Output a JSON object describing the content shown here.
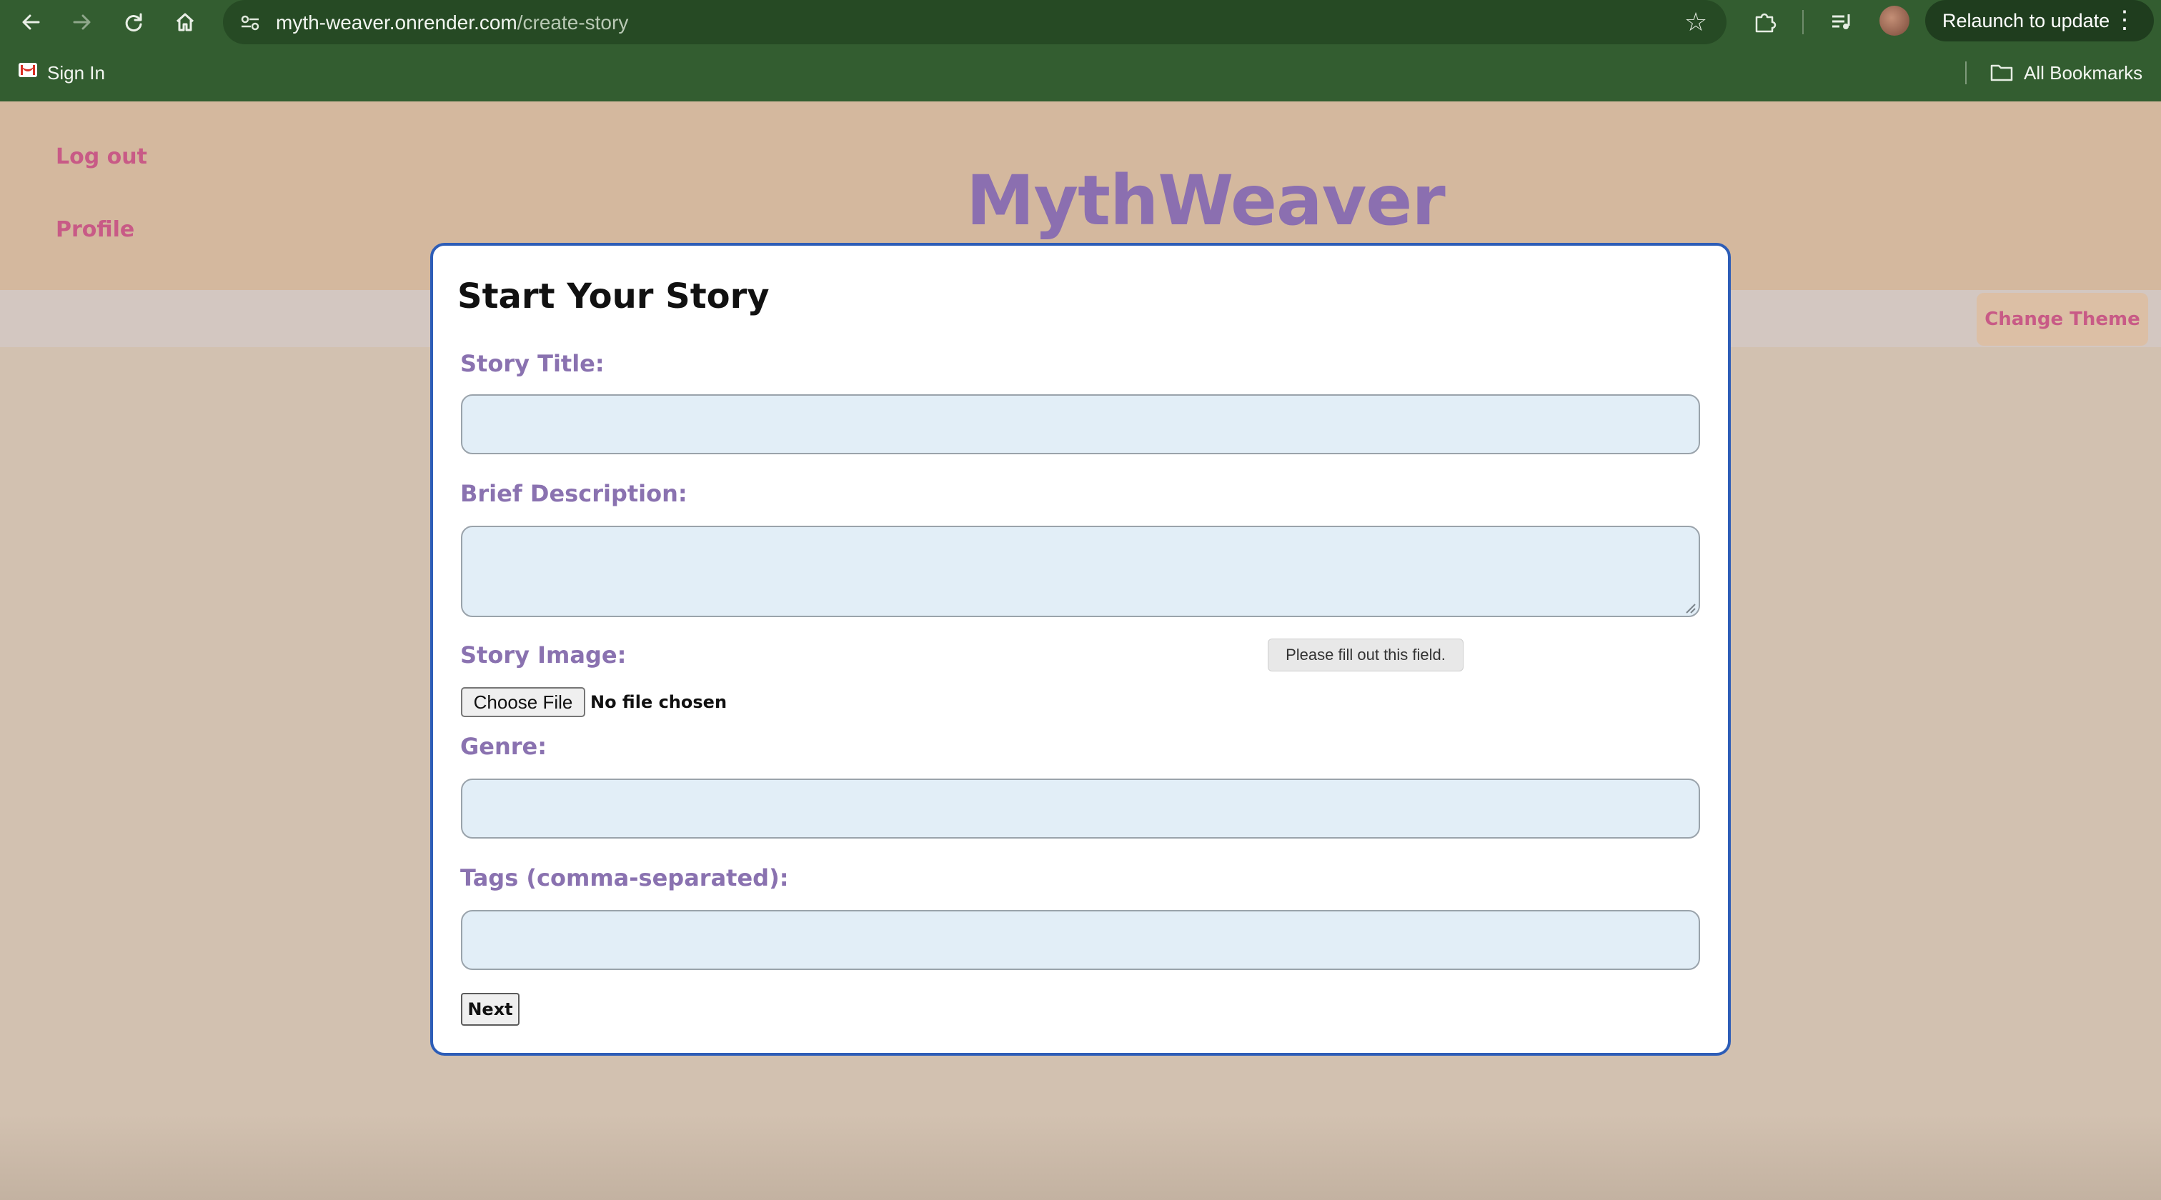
{
  "browser": {
    "back_icon": "arrow-left-icon",
    "forward_icon": "arrow-right-icon",
    "reload_icon": "reload-icon",
    "home_icon": "home-icon",
    "url_host": "myth-weaver.onrender.com",
    "url_path": "/create-story",
    "relaunch_label": "Relaunch to update",
    "bookmarks": {
      "sign_in_label": "Sign In",
      "all_bookmarks_label": "All Bookmarks"
    }
  },
  "header": {
    "brand": "MythWeaver",
    "logout_label": "Log out",
    "profile_label": "Profile",
    "change_theme_label": "Change Theme"
  },
  "form": {
    "title": "Start Your Story",
    "story_title_label": "Story Title:",
    "story_title_value": "",
    "description_label": "Brief Description:",
    "description_value": "",
    "image_label": "Story Image:",
    "choose_file_label": "Choose File",
    "file_status": "No file chosen",
    "validation_tooltip": "Please fill out this field.",
    "genre_label": "Genre:",
    "genre_value": "",
    "tags_label": "Tags (comma-separated):",
    "tags_value": "",
    "next_label": "Next"
  },
  "colors": {
    "browser_chrome": "#335d30",
    "header_bg": "#d4b89e",
    "brand": "#8b6fb0",
    "link": "#c85a86",
    "modal_border": "#2d5db7",
    "input_bg": "#e2eef7"
  }
}
